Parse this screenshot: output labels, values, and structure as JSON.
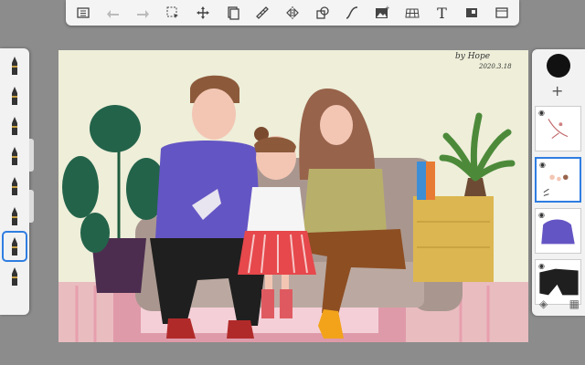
{
  "toolbar": {
    "items": [
      {
        "name": "list-icon"
      },
      {
        "name": "undo-icon"
      },
      {
        "name": "redo-icon"
      },
      {
        "name": "select-icon"
      },
      {
        "name": "move-icon"
      },
      {
        "name": "layer-stack-icon"
      },
      {
        "name": "ruler-icon"
      },
      {
        "name": "symmetry-icon"
      },
      {
        "name": "shapes-icon"
      },
      {
        "name": "curve-icon"
      },
      {
        "name": "image-icon"
      },
      {
        "name": "perspective-grid-icon"
      },
      {
        "name": "text-icon",
        "label": "T"
      },
      {
        "name": "reference-icon"
      },
      {
        "name": "fullscreen-icon"
      }
    ]
  },
  "brushes": {
    "count": 8,
    "selected_index": 6
  },
  "canvas": {
    "signature": "by Hope",
    "date": "2020.3.18"
  },
  "colors": {
    "current_color": "#111111",
    "selection_accent": "#2f7de1"
  },
  "layers": {
    "add_label": "+",
    "thumbnails": [
      {
        "name": "layer-sketch",
        "visible": true
      },
      {
        "name": "layer-figures",
        "visible": true,
        "selected": true
      },
      {
        "name": "layer-purple-sweater",
        "visible": true
      },
      {
        "name": "layer-black-pants",
        "visible": true
      }
    ]
  }
}
